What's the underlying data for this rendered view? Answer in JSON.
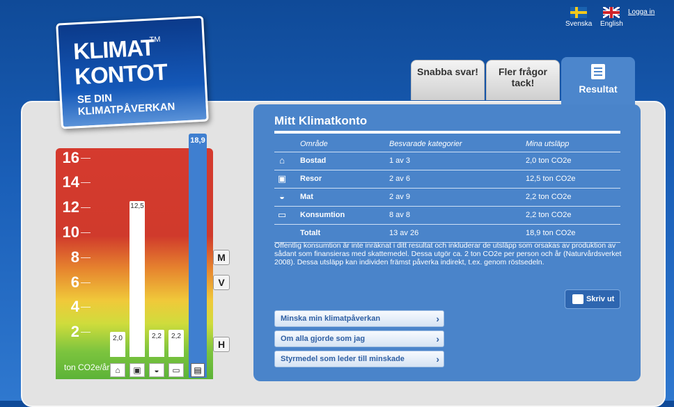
{
  "language": {
    "swedish_label": "Svenska",
    "english_label": "English",
    "login_label": "Logga in"
  },
  "logo": {
    "line1": "KLIMAT",
    "line2": "KONTOT",
    "tm": "TM",
    "tagline": "SE DIN KLIMATPÅVERKAN"
  },
  "tabs": {
    "quick_answers": "Snabba svar!",
    "more_questions_line1": "Fler frågor",
    "more_questions_line2": "tack!",
    "results": "Resultat"
  },
  "chart_data": {
    "type": "bar",
    "title": "",
    "xlabel": "",
    "ylabel": "ton CO2e/år",
    "ylim": [
      0,
      18
    ],
    "yticks": [
      "16",
      "14",
      "12",
      "10",
      "8",
      "6",
      "4",
      "2"
    ],
    "categories": [
      "Bostad",
      "Resor",
      "Mat",
      "Konsumtion"
    ],
    "values": [
      2.0,
      12.5,
      2.2,
      2.2
    ],
    "value_labels": [
      "2,0",
      "12,5",
      "2,2",
      "2,2"
    ],
    "total_value": 18.9,
    "total_label": "18,9",
    "markers": [
      {
        "label": "M",
        "value": 8.0
      },
      {
        "label": "V",
        "value": 6.0
      },
      {
        "label": "H",
        "value": 1.0
      }
    ],
    "colors": {
      "total_bar": "#3f7fd0",
      "bars": "#ffffff"
    }
  },
  "results": {
    "title": "Mitt Klimatkonto",
    "columns": [
      "Område",
      "Besvarade kategorier",
      "Mina utsläpp"
    ],
    "rows": [
      {
        "icon": "house-icon",
        "area": "Bostad",
        "answered": "1 av 3",
        "emission": "2,0 ton CO2e"
      },
      {
        "icon": "suitcase-icon",
        "area": "Resor",
        "answered": "2 av 6",
        "emission": "12,5 ton CO2e"
      },
      {
        "icon": "food-bowl-icon",
        "area": "Mat",
        "answered": "2 av 9",
        "emission": "2,2 ton CO2e"
      },
      {
        "icon": "laptop-icon",
        "area": "Konsumtion",
        "answered": "8 av 8",
        "emission": "2,2 ton CO2e"
      }
    ],
    "total": {
      "area": "Totalt",
      "answered": "13 av 26",
      "emission": "18,9 ton CO2e"
    },
    "note": "Offentlig konsumtion är inte inräknat i ditt resultat och inkluderar de utsläpp som orsakas av produktion av sådant som finansieras med skattemedel. Dessa utgör ca. 2 ton CO2e per person och år (Naturvårdsverket 2008). Dessa utsläpp kan individen främst påverka indirekt, t.ex. genom röstsedeln.",
    "print_label": "Skriv ut",
    "links": [
      "Minska min klimatpåverkan",
      "Om alla gjorde som jag",
      "Styrmedel som leder till minskade"
    ]
  }
}
